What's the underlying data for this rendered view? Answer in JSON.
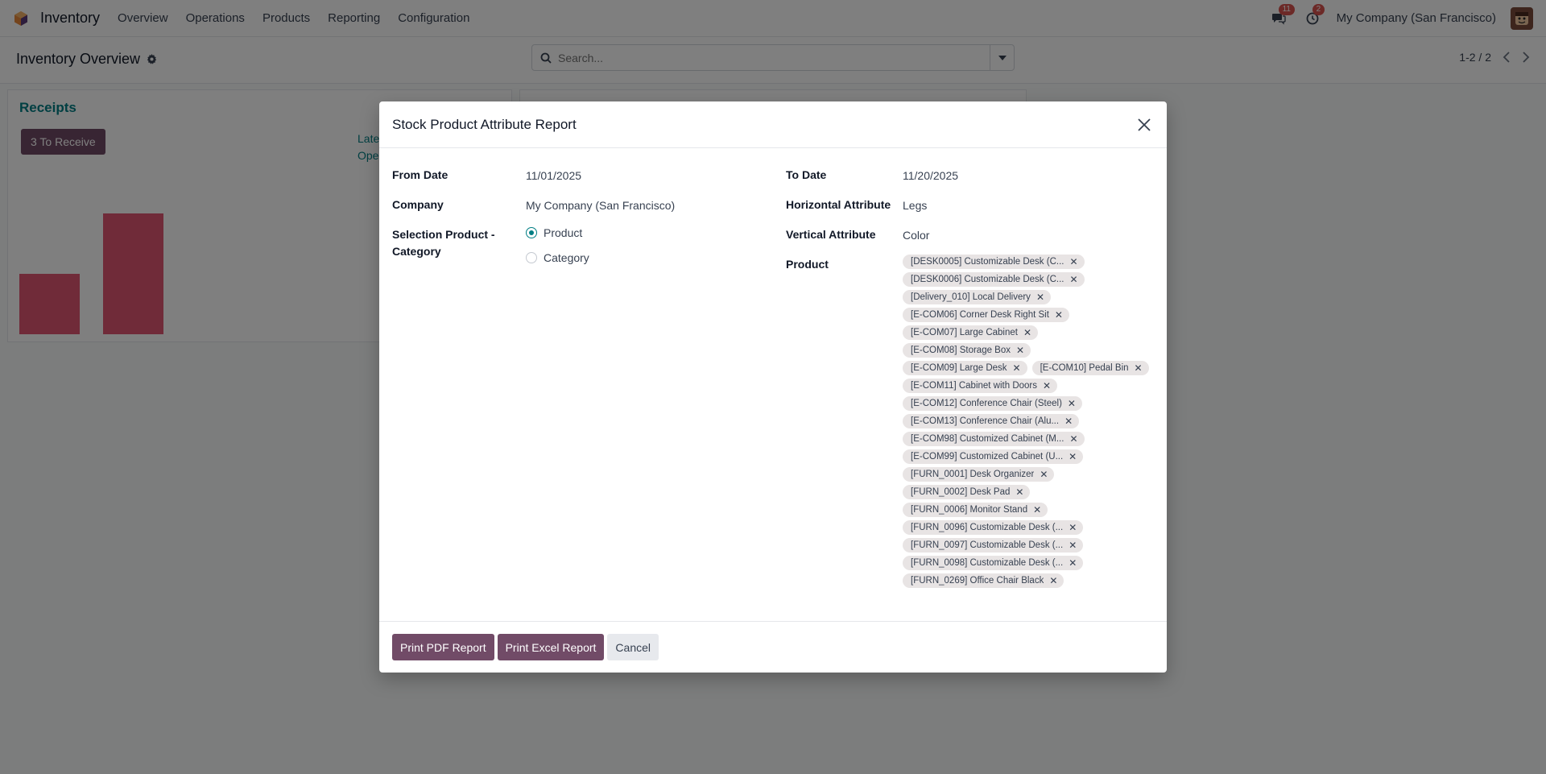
{
  "navbar": {
    "app_name": "Inventory",
    "menu": [
      "Overview",
      "Operations",
      "Products",
      "Reporting",
      "Configuration"
    ],
    "messages_badge": "11",
    "activities_badge": "2",
    "company": "My Company (San Francisco)"
  },
  "control_panel": {
    "breadcrumb": "Inventory Overview",
    "search_placeholder": "Search...",
    "pager": "1-2 / 2"
  },
  "dashboard": {
    "receipts_title": "Receipts",
    "to_receive_label": "3 To Receive",
    "late_label": "Late",
    "ope_label": "Ope"
  },
  "modal": {
    "title": "Stock Product Attribute Report",
    "fields": {
      "from_date_label": "From Date",
      "from_date_value": "11/01/2025",
      "company_label": "Company",
      "company_value": "My Company (San Francisco)",
      "selection_label": "Selection Product - Category",
      "option_product": "Product",
      "option_category": "Category",
      "selected_option": "Product",
      "to_date_label": "To Date",
      "to_date_value": "11/20/2025",
      "horizontal_label": "Horizontal Attribute",
      "horizontal_value": "Legs",
      "vertical_label": "Vertical Attribute",
      "vertical_value": "Color",
      "product_label": "Product"
    },
    "products": [
      "[DESK0005] Customizable Desk (C...",
      "[DESK0006] Customizable Desk (C...",
      "[Delivery_010] Local Delivery",
      "[E-COM06] Corner Desk Right Sit",
      "[E-COM07] Large Cabinet",
      "[E-COM08] Storage Box",
      "[E-COM09] Large Desk",
      "[E-COM10] Pedal Bin",
      "[E-COM11] Cabinet with Doors",
      "[E-COM12] Conference Chair (Steel)",
      "[E-COM13] Conference Chair (Alu...",
      "[E-COM98] Customized Cabinet (M...",
      "[E-COM99] Customized Cabinet (U...",
      "[FURN_0001] Desk Organizer",
      "[FURN_0002] Desk Pad",
      "[FURN_0006] Monitor Stand",
      "[FURN_0096] Customizable Desk (...",
      "[FURN_0097] Customizable Desk (...",
      "[FURN_0098] Customizable Desk (...",
      "[FURN_0269] Office Chair Black"
    ],
    "buttons": {
      "print_pdf": "Print PDF Report",
      "print_excel": "Print Excel Report",
      "cancel": "Cancel"
    }
  },
  "colors": {
    "primary": "#714b67",
    "accent": "#017e84",
    "bar": "#e05673",
    "badge": "#d9534f"
  }
}
